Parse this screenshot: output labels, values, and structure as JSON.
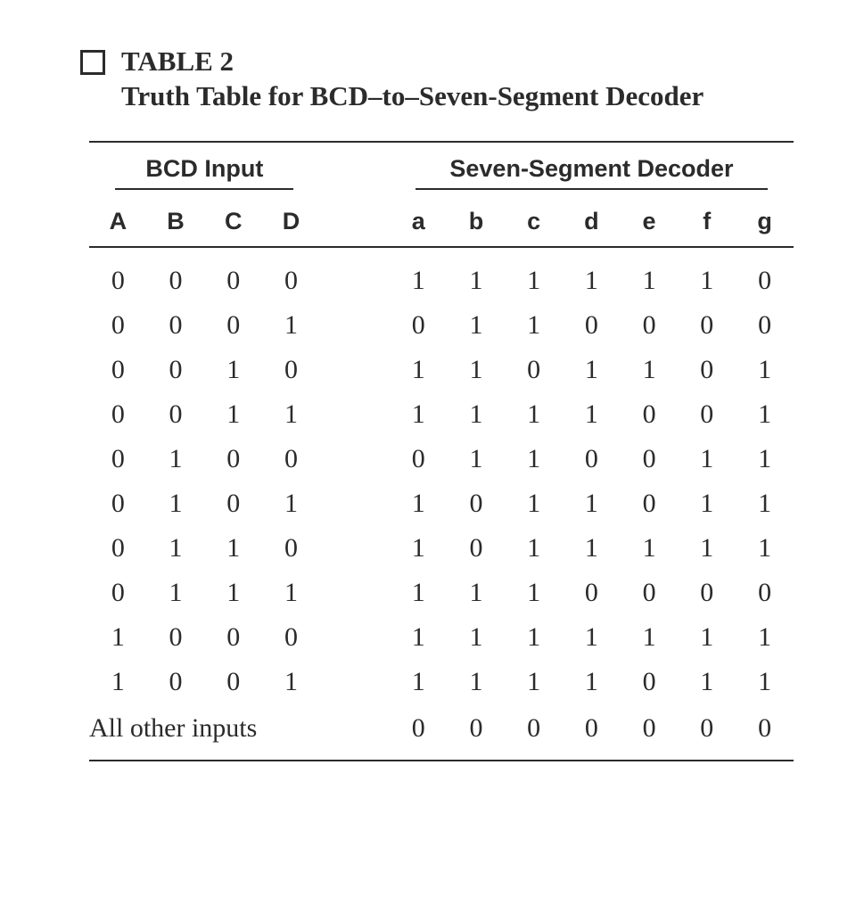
{
  "title": "TABLE 2",
  "subtitle": "Truth Table for BCD–to–Seven-Segment Decoder",
  "group_headers": {
    "input": "BCD Input",
    "output": "Seven-Segment Decoder"
  },
  "columns": {
    "input": [
      "A",
      "B",
      "C",
      "D"
    ],
    "output": [
      "a",
      "b",
      "c",
      "d",
      "e",
      "f",
      "g"
    ]
  },
  "other_inputs_label": "All other inputs",
  "chart_data": {
    "type": "table",
    "title": "Truth Table for BCD-to-Seven-Segment Decoder",
    "input_columns": [
      "A",
      "B",
      "C",
      "D"
    ],
    "output_columns": [
      "a",
      "b",
      "c",
      "d",
      "e",
      "f",
      "g"
    ],
    "rows": [
      {
        "in": [
          0,
          0,
          0,
          0
        ],
        "out": [
          1,
          1,
          1,
          1,
          1,
          1,
          0
        ]
      },
      {
        "in": [
          0,
          0,
          0,
          1
        ],
        "out": [
          0,
          1,
          1,
          0,
          0,
          0,
          0
        ]
      },
      {
        "in": [
          0,
          0,
          1,
          0
        ],
        "out": [
          1,
          1,
          0,
          1,
          1,
          0,
          1
        ]
      },
      {
        "in": [
          0,
          0,
          1,
          1
        ],
        "out": [
          1,
          1,
          1,
          1,
          0,
          0,
          1
        ]
      },
      {
        "in": [
          0,
          1,
          0,
          0
        ],
        "out": [
          0,
          1,
          1,
          0,
          0,
          1,
          1
        ]
      },
      {
        "in": [
          0,
          1,
          0,
          1
        ],
        "out": [
          1,
          0,
          1,
          1,
          0,
          1,
          1
        ]
      },
      {
        "in": [
          0,
          1,
          1,
          0
        ],
        "out": [
          1,
          0,
          1,
          1,
          1,
          1,
          1
        ]
      },
      {
        "in": [
          0,
          1,
          1,
          1
        ],
        "out": [
          1,
          1,
          1,
          0,
          0,
          0,
          0
        ]
      },
      {
        "in": [
          1,
          0,
          0,
          0
        ],
        "out": [
          1,
          1,
          1,
          1,
          1,
          1,
          1
        ]
      },
      {
        "in": [
          1,
          0,
          0,
          1
        ],
        "out": [
          1,
          1,
          1,
          1,
          0,
          1,
          1
        ]
      }
    ],
    "other_inputs_out": [
      0,
      0,
      0,
      0,
      0,
      0,
      0
    ]
  }
}
